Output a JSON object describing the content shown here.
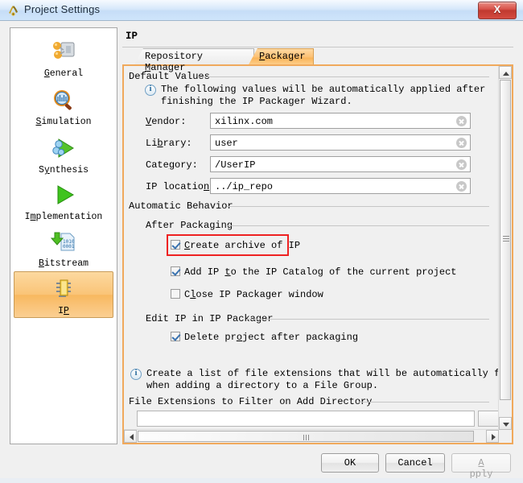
{
  "window": {
    "title": "Project Settings",
    "title_icon": "vivado-logo-icon",
    "close_label": "X"
  },
  "sidebar": {
    "items": [
      {
        "label": "General",
        "mnemonic": "G",
        "icon": "general-gear-icon",
        "selected": false
      },
      {
        "label": "Simulation",
        "mnemonic": "S",
        "icon": "simulation-magnifier-icon",
        "selected": false
      },
      {
        "label": "Synthesis",
        "mnemonic": "y",
        "icon": "synthesis-play-icon",
        "selected": false
      },
      {
        "label": "Implementation",
        "mnemonic": "m",
        "icon": "implementation-play-icon",
        "selected": false
      },
      {
        "label": "Bitstream",
        "mnemonic": "B",
        "icon": "bitstream-download-icon",
        "selected": false
      },
      {
        "label": "IP",
        "mnemonic": "P",
        "icon": "ip-chip-icon",
        "selected": true
      }
    ]
  },
  "pane": {
    "title": "IP",
    "tabs": [
      {
        "label": "Repository Manager",
        "mnemonic": "M",
        "active": false
      },
      {
        "label": "Packager",
        "mnemonic": "P",
        "active": true
      }
    ]
  },
  "default_values": {
    "group_title": "Default Values",
    "info_icon": "info-icon",
    "info_line1": "The following values will be automatically applied after",
    "info_line2": "finishing the IP Packager Wizard.",
    "fields": [
      {
        "label": "Vendor:",
        "mnemonic": "V",
        "value": "xilinx.com",
        "clear_icon": "clear-circle-icon"
      },
      {
        "label": "Library:",
        "mnemonic": "b",
        "value": "user",
        "clear_icon": "clear-circle-icon"
      },
      {
        "label": "Category:",
        "mnemonic": "g",
        "value": "/UserIP",
        "clear_icon": "clear-circle-icon"
      },
      {
        "label": "IP location:",
        "mnemonic": "n",
        "value": "../ip_repo",
        "clear_icon": "clear-circle-icon"
      }
    ]
  },
  "automatic_behavior": {
    "group_title": "Automatic Behavior",
    "after_packaging": {
      "title": "After Packaging",
      "checkboxes": [
        {
          "label": "Create archive of IP",
          "mnemonic": "C",
          "checked": true,
          "highlighted": true
        },
        {
          "label": "Add IP to the IP Catalog of the current project",
          "mnemonic": "t",
          "checked": true,
          "highlighted": false
        },
        {
          "label": "Close IP Packager window",
          "mnemonic": "l",
          "checked": false,
          "highlighted": false
        }
      ]
    },
    "edit_ip": {
      "title": "Edit IP in IP Packager",
      "checkboxes": [
        {
          "label": "Delete project after packaging",
          "mnemonic": "o",
          "checked": true,
          "highlighted": false
        }
      ]
    }
  },
  "file_extensions": {
    "info_icon": "info-icon",
    "info_line1": "Create a list of file extensions that will be automatically filtered",
    "info_line2": "when adding a directory to a File Group.",
    "group_title": "File Extensions to Filter on Add Directory"
  },
  "scrollbars": {
    "vertical": {
      "up_icon": "scroll-up-arrow-icon",
      "down_icon": "scroll-down-arrow-icon",
      "grip_icon": "scroll-grip-icon"
    },
    "horizontal": {
      "left_icon": "scroll-left-arrow-icon",
      "right_icon": "scroll-right-arrow-icon",
      "grip_icon": "scroll-grip-icon"
    }
  },
  "footer": {
    "ok": "OK",
    "cancel": "Cancel",
    "apply": "Apply",
    "apply_mnemonic": "A",
    "apply_disabled": true
  },
  "colors": {
    "accent_orange": "#f0a95c",
    "selection_orange": "#fac477",
    "highlight_red": "#ee2222",
    "titlebar_blue": "#cfe4fa",
    "close_red": "#d9534a"
  }
}
